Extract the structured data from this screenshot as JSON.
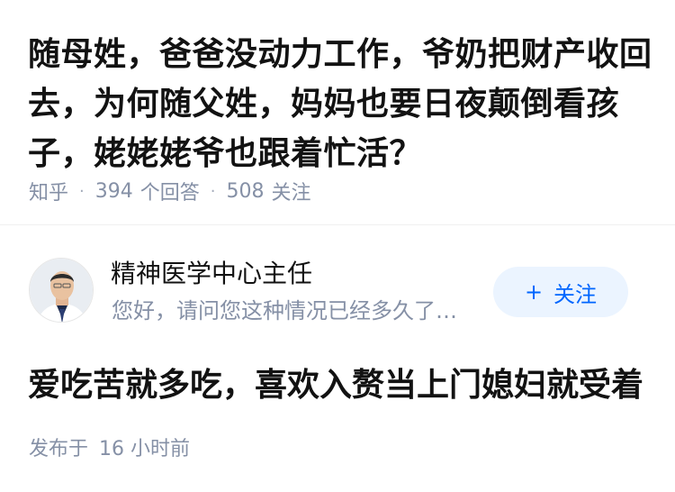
{
  "question": {
    "title": "随母姓，爸爸没动力工作，爷奶把财产收回去，为何随父姓，妈妈也要日夜颠倒看孩子，姥姥姥爷也跟着忙活？",
    "source": "知乎",
    "answer_count": "394",
    "answer_label": "个回答",
    "follower_count": "508",
    "follower_label": "关注"
  },
  "author": {
    "name": "精神医学中心主任",
    "bio": "您好，请问您这种情况已经多久了…",
    "follow_label": "关注",
    "follow_icon": "plus-icon"
  },
  "answer": {
    "excerpt": "爱吃苦就多吃，喜欢入赘当上门媳妇就受着",
    "published_label": "发布于",
    "published_time": "16 小时前"
  },
  "colors": {
    "title": "#121212",
    "meta": "#8590a6",
    "accent": "#0066ff",
    "follow_bg": "#ebf4ff"
  }
}
